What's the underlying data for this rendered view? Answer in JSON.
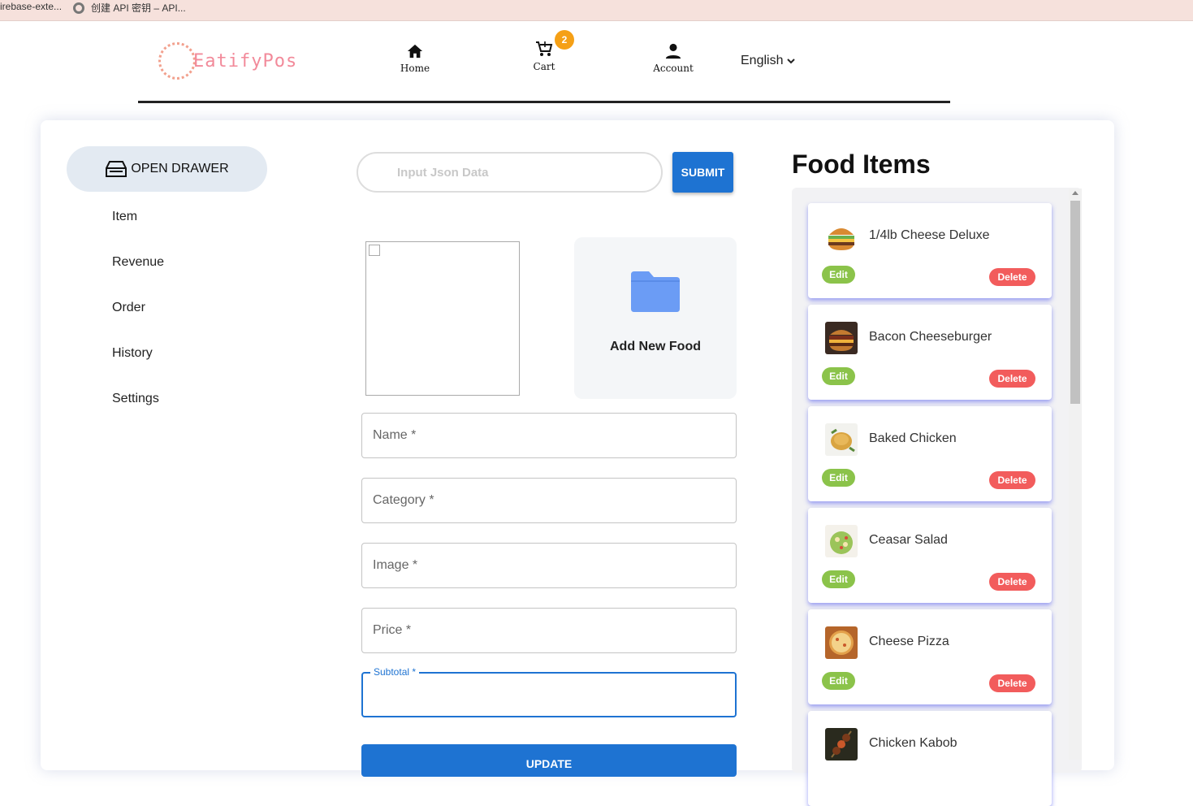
{
  "bookmarks": {
    "item1": "irebase-exte...",
    "item2": "创建 API 密钥 – API..."
  },
  "header": {
    "logo_text": "EatifyPos",
    "nav": {
      "home": "Home",
      "cart": "Cart",
      "account": "Account"
    },
    "cart_count": "2",
    "language": "English"
  },
  "sidebar": {
    "drawer_label": "OPEN DRAWER",
    "items": [
      "Item",
      "Revenue",
      "Order",
      "History",
      "Settings"
    ]
  },
  "form": {
    "json_placeholder": "Input Json Data",
    "submit_label": "SUBMIT",
    "add_food_label": "Add New Food",
    "fields": {
      "name": "Name *",
      "category": "Category *",
      "image": "Image *",
      "price": "Price *",
      "subtotal": "Subtotal *"
    },
    "update_label": "UPDATE"
  },
  "food_list": {
    "title": "Food Items",
    "edit_label": "Edit",
    "delete_label": "Delete",
    "items": [
      "1/4lb Cheese Deluxe",
      "Bacon Cheeseburger",
      "Baked Chicken",
      "Ceasar Salad",
      "Cheese Pizza",
      "Chicken Kabob"
    ]
  },
  "colors": {
    "primary": "#1e73d2",
    "edit": "#8bc34a",
    "delete": "#f25c5c",
    "badge": "#f5a016",
    "logo": "#f28a9a"
  }
}
